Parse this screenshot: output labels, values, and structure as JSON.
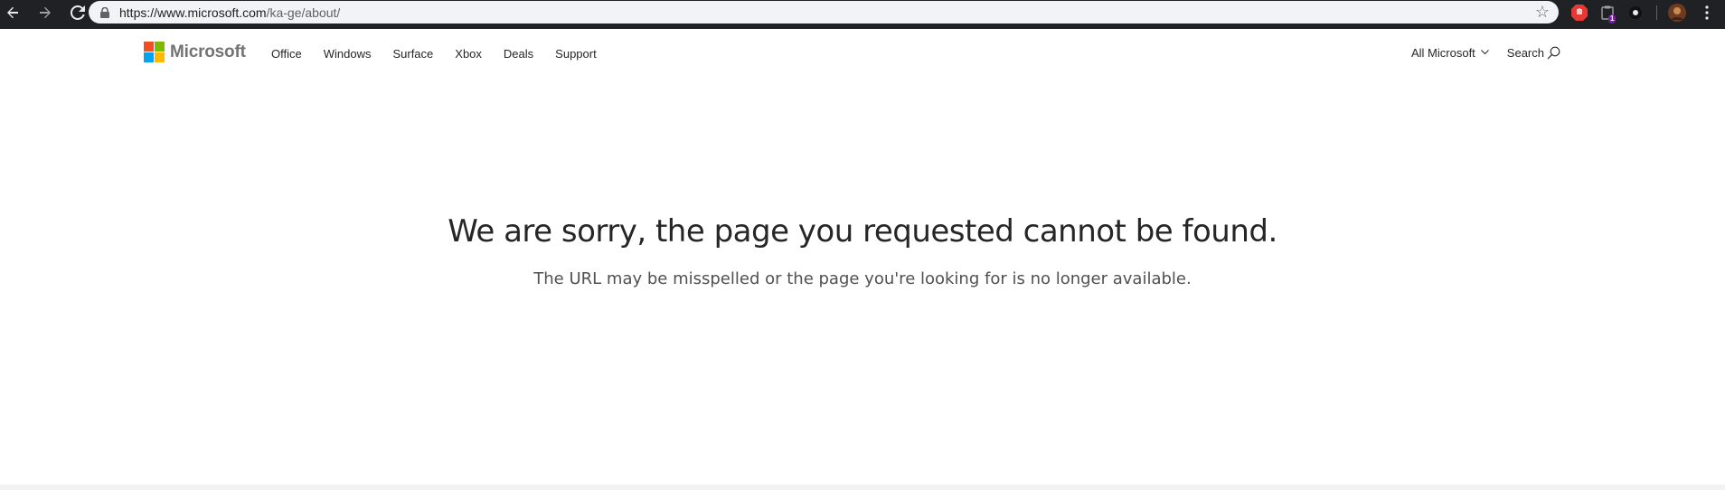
{
  "browser": {
    "url_host": "https://www.microsoft.com",
    "url_path": "/ka-ge/about/",
    "extension_badge": "1"
  },
  "header": {
    "brand": "Microsoft",
    "nav": [
      "Office",
      "Windows",
      "Surface",
      "Xbox",
      "Deals",
      "Support"
    ],
    "all_microsoft": "All Microsoft",
    "search": "Search"
  },
  "error": {
    "title": "We are sorry, the page you requested cannot be found.",
    "subtitle": "The URL may be misspelled or the page you're looking for is no longer available."
  },
  "colors": {
    "logo_red": "#f25022",
    "logo_green": "#7fba00",
    "logo_blue": "#00a4ef",
    "logo_yellow": "#ffb900"
  }
}
